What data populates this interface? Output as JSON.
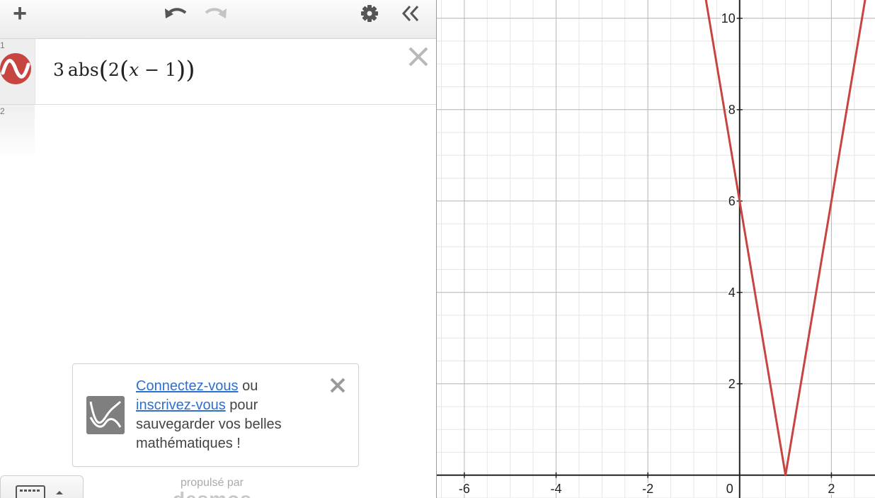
{
  "toolbar": {
    "add_icon": "plus-icon",
    "undo_icon": "undo-icon",
    "redo_icon": "redo-icon",
    "settings_icon": "gear-icon",
    "collapse_icon": "double-chevron-left-icon"
  },
  "expressions": [
    {
      "index": "1",
      "latex_parts": {
        "coef": "3",
        "func": "abs",
        "inner_coef": "2",
        "var": "x",
        "minus": "−",
        "const": "1"
      },
      "color": "#c74440"
    },
    {
      "index": "2"
    }
  ],
  "login_toast": {
    "link_connect": "Connectez-vous",
    "or_text": " ou ",
    "link_signup": "inscrivez-vous",
    "rest_text": " pour sauvegarder vos belles mathématiques !"
  },
  "footer": {
    "powered_by": "propulsé par",
    "brand": "desmos"
  },
  "graph": {
    "curve_color": "#c74440",
    "x_tick_labels": [
      "-6",
      "-4",
      "-2",
      "0",
      "2"
    ],
    "y_tick_labels": [
      "2",
      "4",
      "6",
      "8",
      "10"
    ]
  },
  "chart_data": {
    "type": "line",
    "title": "",
    "xlabel": "",
    "ylabel": "",
    "xlim": [
      -6.6,
      2.95
    ],
    "ylim": [
      -0.5,
      10.4
    ],
    "grid": true,
    "series": [
      {
        "x": [
          -0.8,
          1,
          2.8
        ],
        "y": [
          10.8,
          0,
          10.8
        ]
      }
    ]
  }
}
